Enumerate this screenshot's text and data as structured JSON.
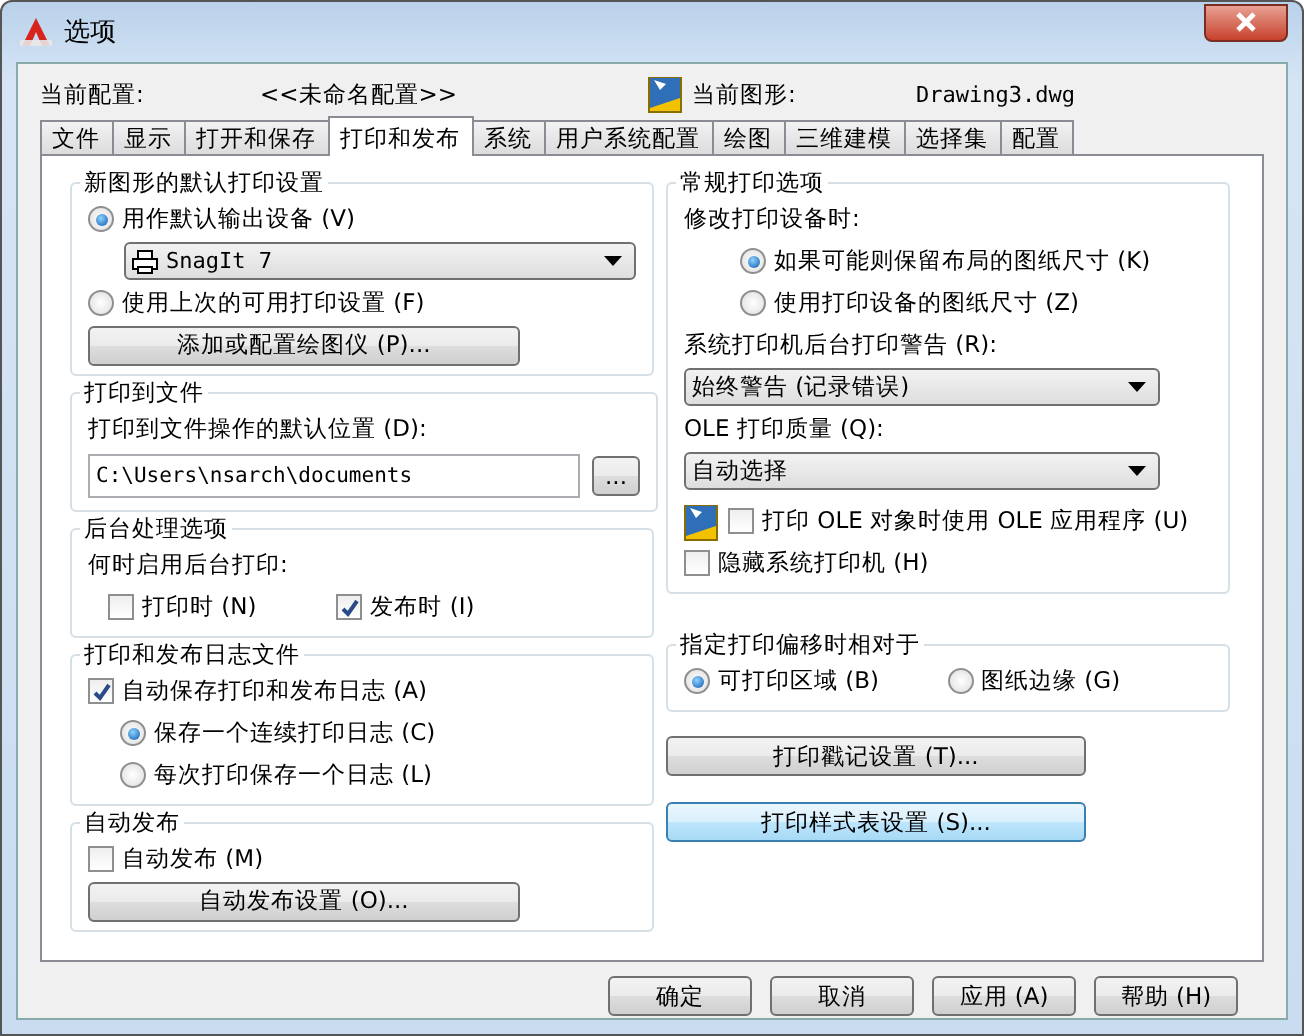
{
  "window": {
    "title": "选项"
  },
  "profile": {
    "label": "当前配置:",
    "value": "<<未命名配置>>"
  },
  "drawing": {
    "label": "当前图形:",
    "value": "Drawing3.dwg"
  },
  "tabs": [
    {
      "label": "文件",
      "selected": false
    },
    {
      "label": "显示",
      "selected": false
    },
    {
      "label": "打开和保存",
      "selected": false
    },
    {
      "label": "打印和发布",
      "selected": true
    },
    {
      "label": "系统",
      "selected": false
    },
    {
      "label": "用户系统配置",
      "selected": false
    },
    {
      "label": "绘图",
      "selected": false
    },
    {
      "label": "三维建模",
      "selected": false
    },
    {
      "label": "选择集",
      "selected": false
    },
    {
      "label": "配置",
      "selected": false
    }
  ],
  "left_groups": [
    {
      "title": "新图形的默认打印设置",
      "items": [
        {
          "kind": "radio",
          "label": "用作默认输出设备 (V)",
          "selected": true
        },
        {
          "kind": "device_dropdown",
          "value": "SnagIt 7"
        },
        {
          "kind": "radio",
          "label": "使用上次的可用打印设置 (F)",
          "selected": false
        },
        {
          "kind": "button",
          "label": "添加或配置绘图仪 (P)..."
        }
      ]
    },
    {
      "title": "打印到文件",
      "items": [
        {
          "kind": "label",
          "label": "打印到文件操作的默认位置 (D):"
        },
        {
          "kind": "path_field",
          "value": "C:\\Users\\nsarch\\documents",
          "button": "..."
        }
      ]
    },
    {
      "title": "后台处理选项",
      "items": [
        {
          "kind": "label",
          "label": "何时启用后台打印:"
        },
        {
          "kind": "option_row",
          "options": [
            {
              "kind": "checkbox",
              "label": "打印时 (N)",
              "checked": false
            },
            {
              "kind": "checkbox",
              "label": "发布时 (I)",
              "checked": true
            }
          ]
        }
      ]
    },
    {
      "title": "打印和发布日志文件",
      "items": [
        {
          "kind": "checkbox",
          "label": "自动保存打印和发布日志 (A)",
          "checked": true,
          "children": [
            {
              "kind": "radio",
              "label": "保存一个连续打印日志 (C)",
              "selected": true
            },
            {
              "kind": "radio",
              "label": "每次打印保存一个日志 (L)",
              "selected": false
            }
          ]
        }
      ]
    },
    {
      "title": "自动发布",
      "items": [
        {
          "kind": "checkbox",
          "label": "自动发布 (M)",
          "checked": false
        },
        {
          "kind": "button",
          "label": "自动发布设置 (O)..."
        }
      ]
    }
  ],
  "right_groups": [
    {
      "title": "常规打印选项",
      "items": [
        {
          "kind": "label",
          "label": "修改打印设备时:",
          "children": [
            {
              "kind": "radio",
              "label": "如果可能则保留布局的图纸尺寸 (K)",
              "selected": true
            },
            {
              "kind": "radio",
              "label": "使用打印设备的图纸尺寸 (Z)",
              "selected": false
            }
          ]
        },
        {
          "kind": "label",
          "label": "系统打印机后台打印警告 (R):"
        },
        {
          "kind": "dropdown",
          "value": "始终警告 (记录错误)"
        },
        {
          "kind": "label",
          "label": "OLE 打印质量 (Q):"
        },
        {
          "kind": "dropdown",
          "value": "自动选择"
        },
        {
          "kind": "ole_checkbox",
          "label": "打印 OLE 对象时使用 OLE 应用程序 (U)",
          "checked": false
        },
        {
          "kind": "checkbox",
          "label": "隐藏系统打印机 (H)",
          "checked": false
        }
      ]
    },
    {
      "title": "指定打印偏移时相对于",
      "items": [
        {
          "kind": "option_row",
          "options": [
            {
              "kind": "radio",
              "label": "可打印区域 (B)",
              "selected": true
            },
            {
              "kind": "radio",
              "label": "图纸边缘 (G)",
              "selected": false
            }
          ]
        }
      ]
    }
  ],
  "right_buttons": [
    {
      "label": "打印戳记设置 (T)...",
      "highlighted": false
    },
    {
      "label": "打印样式表设置 (S)...",
      "highlighted": true
    }
  ],
  "footer_buttons": [
    {
      "label": "确定"
    },
    {
      "label": "取消"
    },
    {
      "label": "应用 (A)"
    },
    {
      "label": "帮助 (H)"
    }
  ]
}
